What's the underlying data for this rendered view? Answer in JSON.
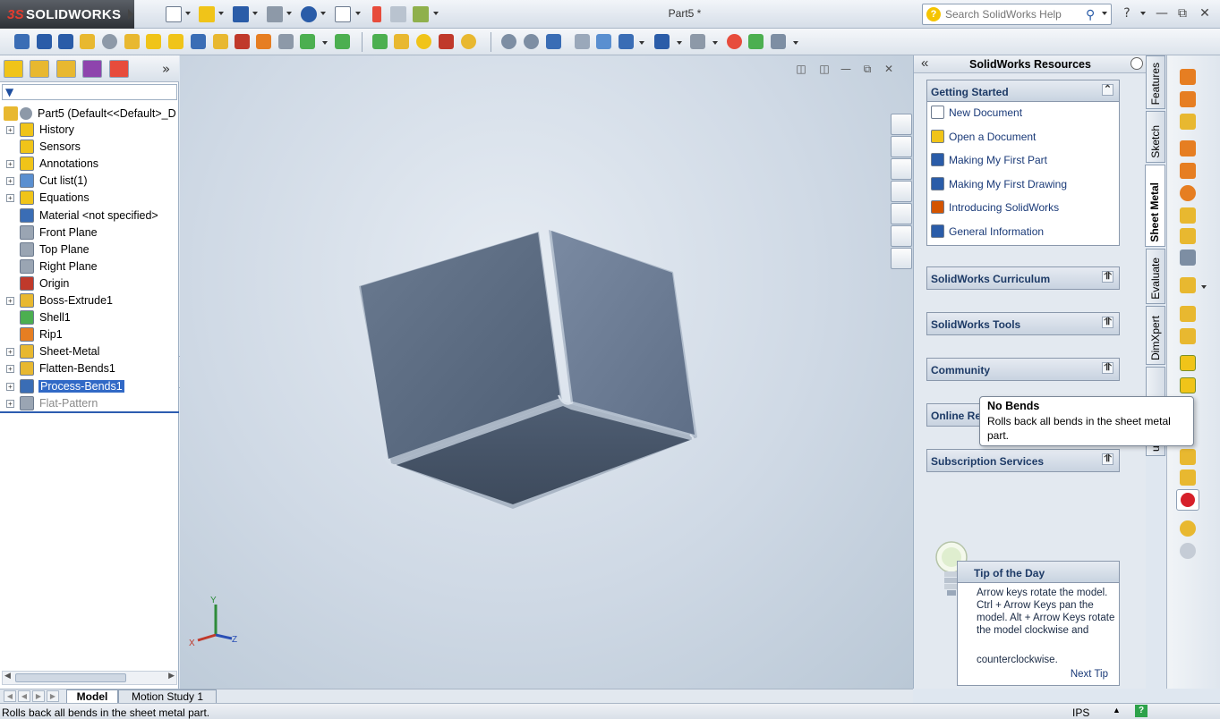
{
  "app": {
    "brand_ds": "3S",
    "brand_name": "SOLIDWORKS",
    "document_title": "Part5 *",
    "search_placeholder": "Search SolidWorks Help"
  },
  "feature_tree": {
    "root": "Part5  (Default<<Default>_D",
    "items": [
      {
        "label": "History",
        "expandable": true,
        "icon": "history-icon",
        "color": "#f0c419"
      },
      {
        "label": "Sensors",
        "expandable": false,
        "icon": "sensor-icon",
        "color": "#f0c419"
      },
      {
        "label": "Annotations",
        "expandable": true,
        "icon": "annotations-icon",
        "color": "#f0c419"
      },
      {
        "label": "Cut list(1)",
        "expandable": true,
        "icon": "cut-list-icon",
        "color": "#5a8fd0"
      },
      {
        "label": "Equations",
        "expandable": true,
        "icon": "equations-icon",
        "color": "#f0c419"
      },
      {
        "label": "Material <not specified>",
        "expandable": false,
        "icon": "material-icon",
        "color": "#3a6db5"
      },
      {
        "label": "Front Plane",
        "expandable": false,
        "icon": "plane-icon",
        "color": "#9aa5b3"
      },
      {
        "label": "Top Plane",
        "expandable": false,
        "icon": "plane-icon",
        "color": "#9aa5b3"
      },
      {
        "label": "Right Plane",
        "expandable": false,
        "icon": "plane-icon",
        "color": "#9aa5b3"
      },
      {
        "label": "Origin",
        "expandable": false,
        "icon": "origin-icon",
        "color": "#c0392b"
      },
      {
        "label": "Boss-Extrude1",
        "expandable": true,
        "icon": "boss-extrude-icon",
        "color": "#e8b830"
      },
      {
        "label": "Shell1",
        "expandable": false,
        "icon": "shell-icon",
        "color": "#4caf50"
      },
      {
        "label": "Rip1",
        "expandable": false,
        "icon": "rip-icon",
        "color": "#e67e22"
      },
      {
        "label": "Sheet-Metal",
        "expandable": true,
        "icon": "sheet-metal-icon",
        "color": "#e8b830"
      },
      {
        "label": "Flatten-Bends1",
        "expandable": true,
        "icon": "flatten-bends-icon",
        "color": "#e8b830"
      },
      {
        "label": "Process-Bends1",
        "expandable": true,
        "icon": "process-bends-icon",
        "color": "#3a6db5",
        "selected": true
      },
      {
        "label": "Flat-Pattern",
        "expandable": true,
        "icon": "flat-pattern-icon",
        "color": "#9aa5b3",
        "suppressed": true
      }
    ]
  },
  "task_pane": {
    "title": "SolidWorks Resources",
    "getting_started": {
      "title": "Getting Started",
      "items": [
        {
          "label": "New Document",
          "icon": "new-document-icon",
          "color": "#ffffff"
        },
        {
          "label": "Open a Document",
          "icon": "open-folder-icon",
          "color": "#f0c419"
        },
        {
          "label": "Making My First Part",
          "icon": "graduation-cap-icon",
          "color": "#2a5ca8"
        },
        {
          "label": "Making My First Drawing",
          "icon": "graduation-cap-icon",
          "color": "#2a5ca8"
        },
        {
          "label": "Introducing SolidWorks",
          "icon": "movie-icon",
          "color": "#d35400"
        },
        {
          "label": "General Information",
          "icon": "info-icon",
          "color": "#2a5ca8"
        }
      ]
    },
    "sections": [
      "SolidWorks Curriculum",
      "SolidWorks Tools",
      "Community",
      "Online Re",
      "Subscription Services"
    ],
    "tip": {
      "title": "Tip of the Day",
      "body": "Arrow keys rotate the model. Ctrl + Arrow Keys pan the model. Alt + Arrow Keys rotate the model clockwise and",
      "body_end": "counterclockwise.",
      "next": "Next Tip"
    }
  },
  "vertical_tabs": [
    "Features",
    "Sketch",
    "Sheet Metal",
    "Evaluate",
    "DimXpert",
    "ucts"
  ],
  "tooltip": {
    "title": "No Bends",
    "body": "Rolls back all bends in the sheet metal part."
  },
  "bottom_tabs": [
    "Model",
    "Motion Study 1"
  ],
  "status": {
    "message": "Rolls back all bends in the sheet metal part.",
    "units": "IPS",
    "help": "?"
  },
  "triad": {
    "x": "X",
    "y": "Y",
    "z": "Z"
  },
  "colors": {
    "accent": "#3169c6",
    "part": "#5a6b82"
  }
}
